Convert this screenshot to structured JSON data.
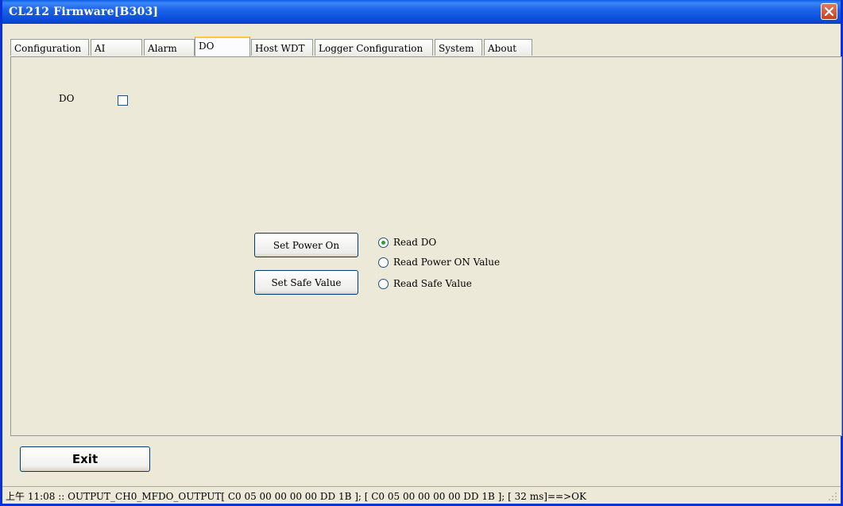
{
  "window": {
    "title": "CL212 Firmware[B303]"
  },
  "tabs": [
    {
      "label": "Configuration"
    },
    {
      "label": "AI"
    },
    {
      "label": "Alarm"
    },
    {
      "label": "DO"
    },
    {
      "label": "Host WDT"
    },
    {
      "label": "Logger Configuration"
    },
    {
      "label": "System"
    },
    {
      "label": "About"
    }
  ],
  "active_tab": "DO",
  "do_panel": {
    "do_label": "DO",
    "do_checked": false,
    "set_power_on_label": "Set Power On",
    "set_safe_value_label": "Set Safe Value",
    "radios": [
      {
        "label": "Read DO",
        "selected": true
      },
      {
        "label": "Read Power ON Value",
        "selected": false
      },
      {
        "label": "Read Safe Value",
        "selected": false
      }
    ]
  },
  "footer": {
    "exit_label": "Exit",
    "status_text": "上午 11:08 :: OUTPUT_CH0_MFDO_OUTPUT[ C0 05 00 00 00 00 DD 1B ]; [ C0 05 00 00 00 00 DD 1B  ]; [ 32 ms]==>OK"
  },
  "colors": {
    "titlebar": "#0a4fd9",
    "window_bg": "#ece9d8",
    "active_tab_accent": "#ffc83c",
    "radio_dot": "#2e9e2e"
  }
}
